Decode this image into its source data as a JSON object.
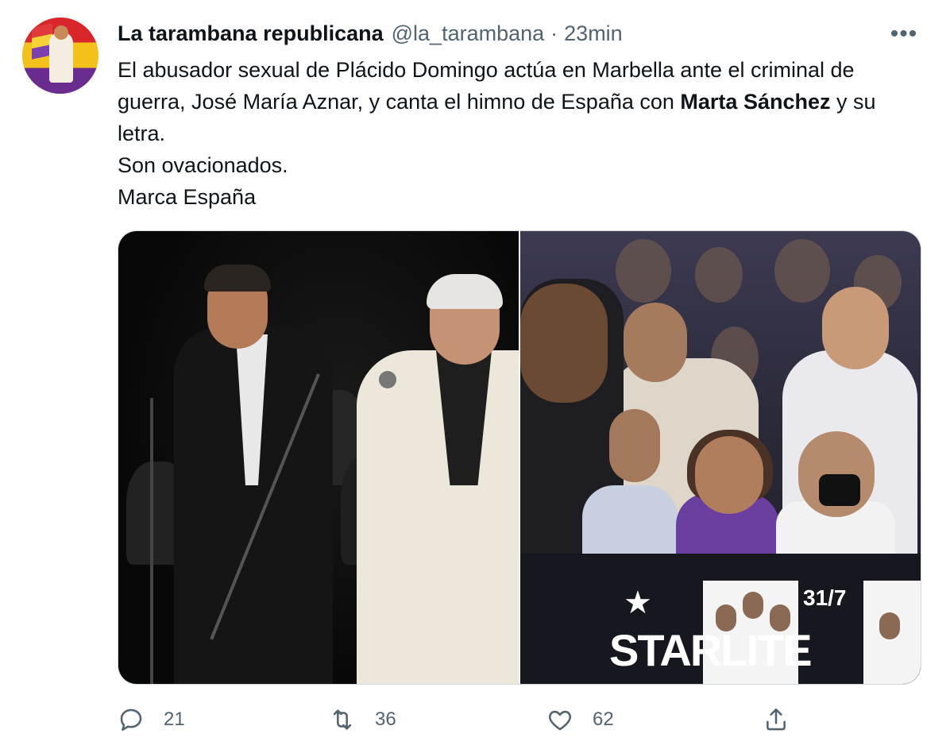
{
  "tweet": {
    "author": {
      "display_name": "La tarambana republicana",
      "handle": "@la_tarambana",
      "separator": "·",
      "time": "23min",
      "avatar": "republic-flag-avatar"
    },
    "text": {
      "line1_part1": "El abusador sexual de Plácido Domingo actúa en Marbella ante el criminal de guerra, José María Aznar, y canta el himno de España con ",
      "line1_bold": "Marta Sánchez",
      "line1_part2": " y su letra.",
      "line2": "Son ovacionados.",
      "line3": "Marca España"
    },
    "media": {
      "photo_left": "concert-stage-photo",
      "photo_right": "audience-photo",
      "banner_word": "STARLITE",
      "banner_date": "31/7"
    },
    "actions": {
      "reply": {
        "icon": "reply-icon",
        "count": "21"
      },
      "retweet": {
        "icon": "retweet-icon",
        "count": "36"
      },
      "like": {
        "icon": "heart-icon",
        "count": "62"
      },
      "share": {
        "icon": "share-icon"
      }
    },
    "more_icon": "more-icon",
    "more_glyph": "•••"
  },
  "colors": {
    "text_primary": "#0f1419",
    "text_secondary": "#536471",
    "border": "#cfd9de"
  }
}
